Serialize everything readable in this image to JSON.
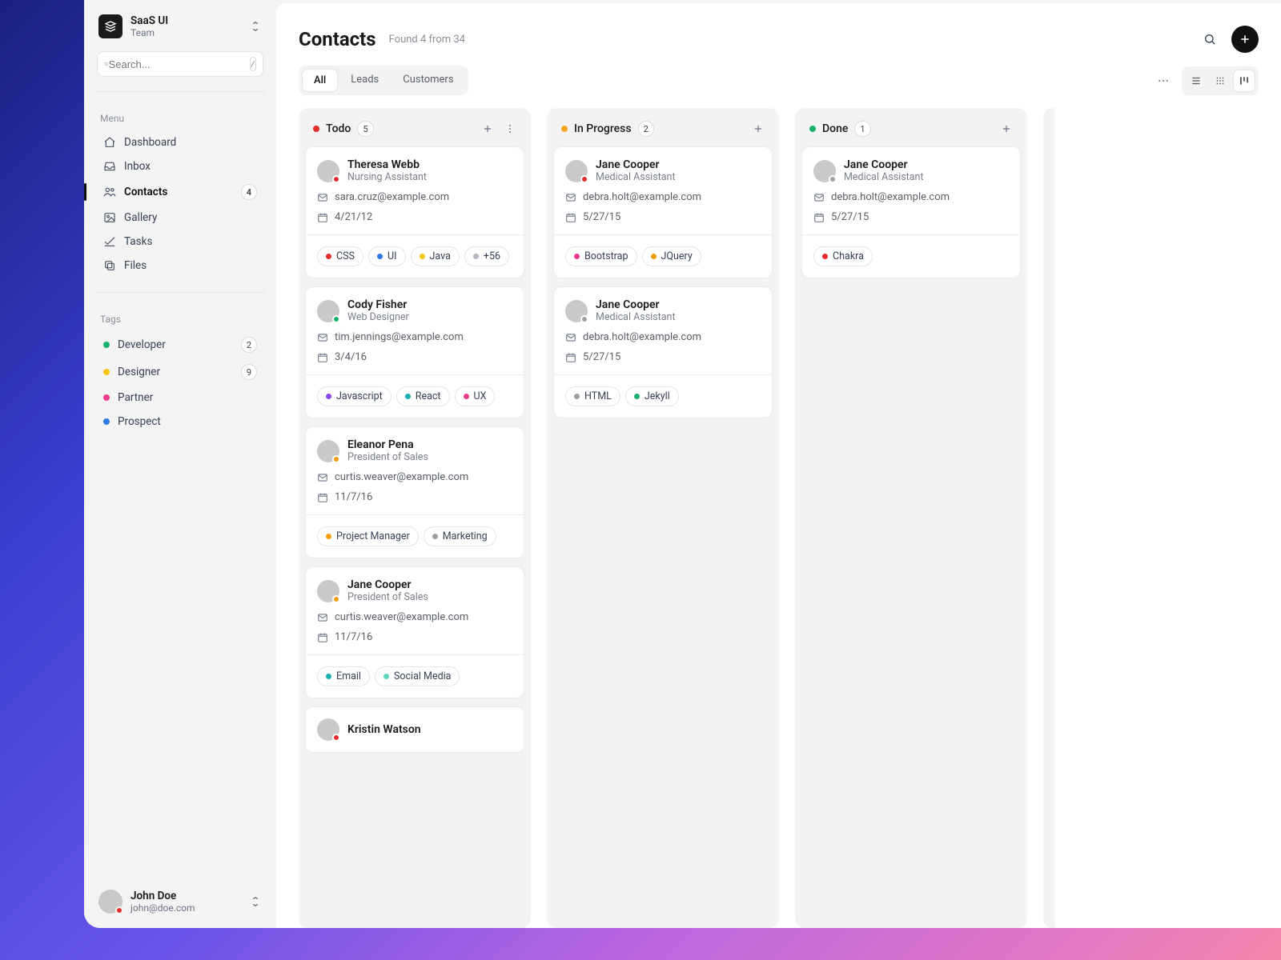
{
  "workspace": {
    "name": "SaaS UI",
    "team": "Team"
  },
  "search": {
    "placeholder": "Search...",
    "shortcut": "/"
  },
  "sidebar": {
    "menu_label": "Menu",
    "items": [
      {
        "label": "Dashboard",
        "icon": "home"
      },
      {
        "label": "Inbox",
        "icon": "inbox"
      },
      {
        "label": "Contacts",
        "icon": "users",
        "active": true,
        "count": "4"
      },
      {
        "label": "Gallery",
        "icon": "image"
      },
      {
        "label": "Tasks",
        "icon": "check"
      },
      {
        "label": "Files",
        "icon": "copy"
      }
    ],
    "tags_label": "Tags",
    "tags": [
      {
        "label": "Developer",
        "color": "#18b26b",
        "count": "2"
      },
      {
        "label": "Designer",
        "color": "#f5c518",
        "count": "9"
      },
      {
        "label": "Partner",
        "color": "#e83d8c"
      },
      {
        "label": "Prospect",
        "color": "#2f7be5"
      }
    ]
  },
  "user": {
    "name": "John Doe",
    "email": "john@doe.com",
    "status": "#e32d2d"
  },
  "page": {
    "title": "Contacts",
    "subtitle": "Found 4 from 34"
  },
  "tabs": [
    {
      "label": "All",
      "active": true
    },
    {
      "label": "Leads"
    },
    {
      "label": "Customers"
    }
  ],
  "columns": [
    {
      "title": "Todo",
      "dot": "#e32d2d",
      "count": "5",
      "menu": true,
      "cards": [
        {
          "name": "Theresa Webb",
          "role": "Nursing Assistant",
          "email": "sara.cruz@example.com",
          "date": "4/21/12",
          "status": "#e32d2d",
          "tags": [
            {
              "t": "CSS",
              "c": "#e32d2d"
            },
            {
              "t": "UI",
              "c": "#2f7be5"
            },
            {
              "t": "Java",
              "c": "#f5c518"
            },
            {
              "t": "+56",
              "c": "#b4b9c0"
            }
          ]
        },
        {
          "name": "Cody Fisher",
          "role": "Web Designer",
          "email": "tim.jennings@example.com",
          "date": "3/4/16",
          "status": "#18b26b",
          "tags": [
            {
              "t": "Javascript",
              "c": "#8a49e8"
            },
            {
              "t": "React",
              "c": "#16b2b2"
            },
            {
              "t": "UX",
              "c": "#e83d8c"
            }
          ]
        },
        {
          "name": "Eleanor Pena",
          "role": "President of Sales",
          "email": "curtis.weaver@example.com",
          "date": "11/7/16",
          "status": "#f59e0b",
          "tags": [
            {
              "t": "Project Manager",
              "c": "#f59e0b"
            },
            {
              "t": "Marketing",
              "c": "#9aa0a6"
            }
          ]
        },
        {
          "name": "Jane Cooper",
          "role": "President of Sales",
          "email": "curtis.weaver@example.com",
          "date": "11/7/16",
          "status": "#f59e0b",
          "tags": [
            {
              "t": "Email",
              "c": "#16b2b2"
            },
            {
              "t": "Social Media",
              "c": "#5dd6be"
            }
          ]
        },
        {
          "name": "Kristin Watson",
          "role": "",
          "email": "",
          "date": "",
          "status": "#e32d2d",
          "tags": []
        }
      ]
    },
    {
      "title": "In Progress",
      "dot": "#f5a623",
      "count": "2",
      "cards": [
        {
          "name": "Jane Cooper",
          "role": "Medical Assistant",
          "email": "debra.holt@example.com",
          "date": "5/27/15",
          "status": "#e32d2d",
          "tags": [
            {
              "t": "Bootstrap",
              "c": "#e83d8c"
            },
            {
              "t": "JQuery",
              "c": "#f59e0b"
            }
          ]
        },
        {
          "name": "Jane Cooper",
          "role": "Medical Assistant",
          "email": "debra.holt@example.com",
          "date": "5/27/15",
          "status": "#9aa0a6",
          "tags": [
            {
              "t": "HTML",
              "c": "#9aa0a6"
            },
            {
              "t": "Jekyll",
              "c": "#18b26b"
            }
          ]
        }
      ]
    },
    {
      "title": "Done",
      "dot": "#18b26b",
      "count": "1",
      "cards": [
        {
          "name": "Jane Cooper",
          "role": "Medical Assistant",
          "email": "debra.holt@example.com",
          "date": "5/27/15",
          "status": "#9aa0a6",
          "tags": [
            {
              "t": "Chakra",
              "c": "#e32d2d"
            }
          ]
        }
      ]
    }
  ]
}
